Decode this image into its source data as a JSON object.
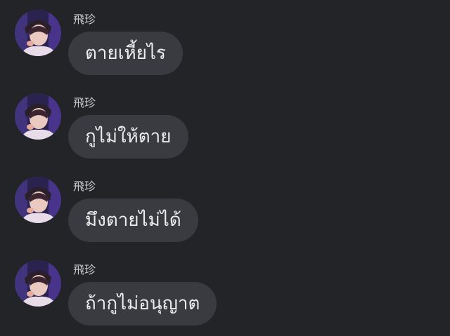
{
  "messages": [
    {
      "sender": "飛珍",
      "text": "ตายเหี้ยไร",
      "avatar_icon": "user-avatar-photo"
    },
    {
      "sender": "飛珍",
      "text": "กูไม่ให้ตาย",
      "avatar_icon": "user-avatar-photo"
    },
    {
      "sender": "飛珍",
      "text": "มึงตายไม่ได้",
      "avatar_icon": "user-avatar-photo"
    },
    {
      "sender": "飛珍",
      "text": "ถ้ากูไม่อนุญาต",
      "avatar_icon": "user-avatar-photo"
    }
  ],
  "colors": {
    "background": "#232428",
    "bubble": "#3a3b40",
    "text": "#ececef",
    "name": "#c9cacf"
  }
}
